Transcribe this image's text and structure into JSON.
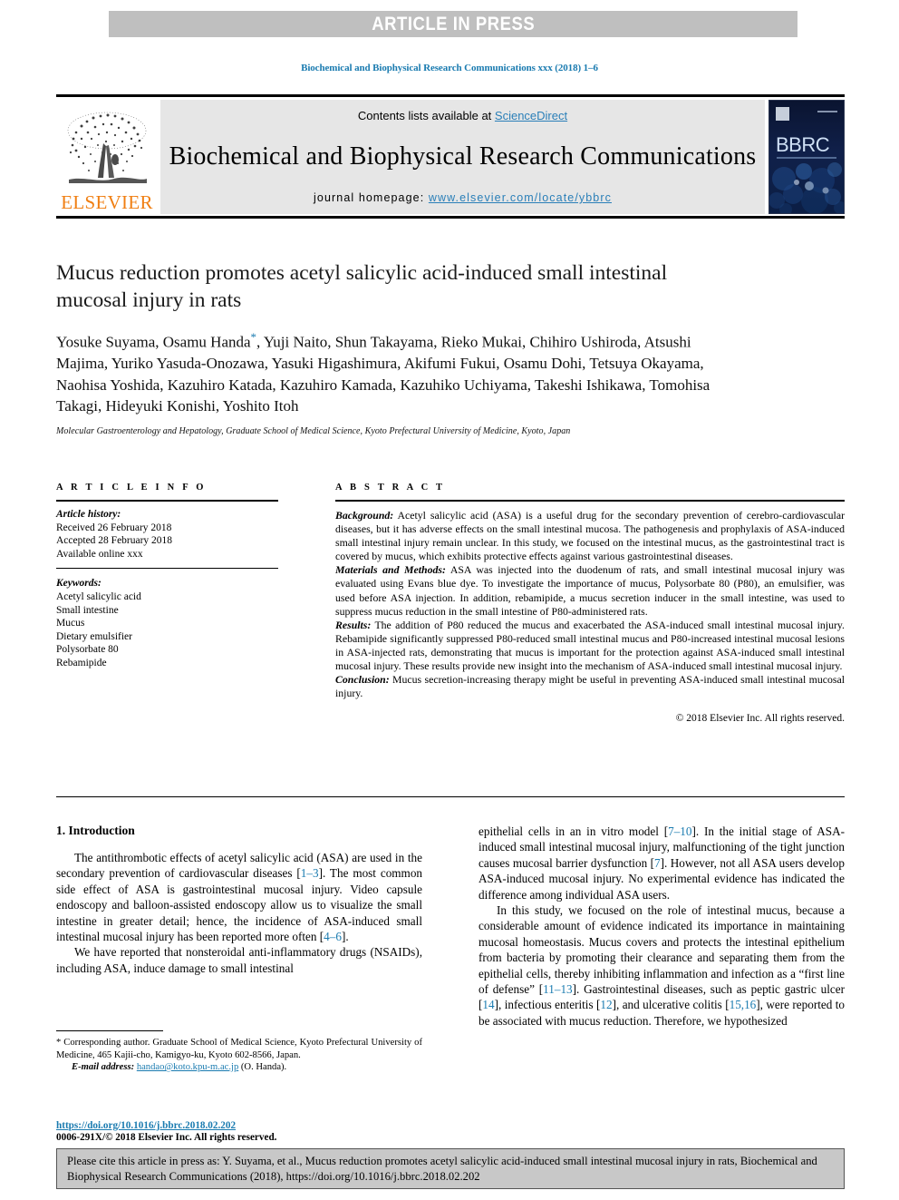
{
  "banner": {
    "label": "ARTICLE IN PRESS"
  },
  "running_head": "Biochemical and Biophysical Research Communications xxx (2018) 1–6",
  "masthead": {
    "publisher": "ELSEVIER",
    "contents_prefix": "Contents lists available at ",
    "contents_link": "ScienceDirect",
    "journal_title": "Biochemical and Biophysical Research Communications",
    "homepage_label": "journal homepage: ",
    "homepage_link": "www.elsevier.com/locate/ybbrc",
    "cover_code": "BBRC"
  },
  "article": {
    "title": "Mucus reduction promotes acetyl salicylic acid-induced small intestinal mucosal injury in rats",
    "authors": "Yosuke Suyama, Osamu Handa",
    "authors_rest": ", Yuji Naito, Shun Takayama, Rieko Mukai, Chihiro Ushiroda, Atsushi Majima, Yuriko Yasuda-Onozawa, Yasuki Higashimura, Akifumi Fukui, Osamu Dohi, Tetsuya Okayama, Naohisa Yoshida, Kazuhiro Katada, Kazuhiro Kamada, Kazuhiko Uchiyama, Takeshi Ishikawa, Tomohisa Takagi, Hideyuki Konishi, Yoshito Itoh",
    "corresponding_marker": "*",
    "affiliation": "Molecular Gastroenterology and Hepatology, Graduate School of Medical Science, Kyoto Prefectural University of Medicine, Kyoto, Japan"
  },
  "article_info": {
    "heading": "A R T I C L E   I N F O",
    "history_label": "Article history:",
    "history": [
      "Received 26 February 2018",
      "Accepted 28 February 2018",
      "Available online xxx"
    ],
    "keywords_label": "Keywords:",
    "keywords": [
      "Acetyl salicylic acid",
      "Small intestine",
      "Mucus",
      "Dietary emulsifier",
      "Polysorbate 80",
      "Rebamipide"
    ]
  },
  "abstract": {
    "heading": "A B S T R A C T",
    "sections": [
      {
        "label": "Background:",
        "text": " Acetyl salicylic acid (ASA) is a useful drug for the secondary prevention of cerebro-cardiovascular diseases, but it has adverse effects on the small intestinal mucosa. The pathogenesis and prophylaxis of ASA-induced small intestinal injury remain unclear. In this study, we focused on the intestinal mucus, as the gastrointestinal tract is covered by mucus, which exhibits protective effects against various gastrointestinal diseases."
      },
      {
        "label": "Materials and Methods:",
        "text": " ASA was injected into the duodenum of rats, and small intestinal mucosal injury was evaluated using Evans blue dye. To investigate the importance of mucus, Polysorbate 80 (P80), an emulsifier, was used before ASA injection. In addition, rebamipide, a mucus secretion inducer in the small intestine, was used to suppress mucus reduction in the small intestine of P80-administered rats."
      },
      {
        "label": "Results:",
        "text": " The addition of P80 reduced the mucus and exacerbated the ASA-induced small intestinal mucosal injury. Rebamipide significantly suppressed P80-reduced small intestinal mucus and P80-increased intestinal mucosal lesions in ASA-injected rats, demonstrating that mucus is important for the protection against ASA-induced small intestinal mucosal injury. These results provide new insight into the mechanism of ASA-induced small intestinal mucosal injury."
      },
      {
        "label": "Conclusion:",
        "text": " Mucus secretion-increasing therapy might be useful in preventing ASA-induced small intestinal mucosal injury."
      }
    ],
    "copyright": "© 2018 Elsevier Inc. All rights reserved."
  },
  "introduction": {
    "heading": "1. Introduction",
    "left_paragraphs": [
      {
        "runs": [
          {
            "t": "The antithrombotic effects of acetyl salicylic acid (ASA) are used in the secondary prevention of cardiovascular diseases ["
          },
          {
            "t": "1–3",
            "ref": true
          },
          {
            "t": "]. The most common side effect of ASA is gastrointestinal mucosal injury. Video capsule endoscopy and balloon-assisted endoscopy allow us to visualize the small intestine in greater detail; hence, the incidence of ASA-induced small intestinal mucosal injury has been reported more often ["
          },
          {
            "t": "4–6",
            "ref": true
          },
          {
            "t": "]."
          }
        ]
      },
      {
        "runs": [
          {
            "t": "We have reported that nonsteroidal anti-inflammatory drugs (NSAIDs), including ASA, induce damage to small intestinal"
          }
        ]
      }
    ],
    "right_paragraphs": [
      {
        "runs": [
          {
            "t": "epithelial cells in an in vitro model ["
          },
          {
            "t": "7–10",
            "ref": true
          },
          {
            "t": "]. In the initial stage of ASA-induced small intestinal mucosal injury, malfunctioning of the tight junction causes mucosal barrier dysfunction ["
          },
          {
            "t": "7",
            "ref": true
          },
          {
            "t": "]. However, not all ASA users develop ASA-induced mucosal injury. No experimental evidence has indicated the difference among individual ASA users."
          }
        ],
        "noindent": true
      },
      {
        "runs": [
          {
            "t": "In this study, we focused on the role of intestinal mucus, because a considerable amount of evidence indicated its importance in maintaining mucosal homeostasis. Mucus covers and protects the intestinal epithelium from bacteria by promoting their clearance and separating them from the epithelial cells, thereby inhibiting inflammation and infection as a “first line of defense” ["
          },
          {
            "t": "11–13",
            "ref": true
          },
          {
            "t": "]. Gastrointestinal diseases, such as peptic gastric ulcer ["
          },
          {
            "t": "14",
            "ref": true
          },
          {
            "t": "], infectious enteritis ["
          },
          {
            "t": "12",
            "ref": true
          },
          {
            "t": "], and ulcerative colitis ["
          },
          {
            "t": "15,16",
            "ref": true
          },
          {
            "t": "], were reported to be associated with mucus reduction. Therefore, we hypothesized"
          }
        ]
      }
    ]
  },
  "footnote": {
    "corresponding": "* Corresponding author. Graduate School of Medical Science, Kyoto Prefectural University of Medicine, 465 Kajii-cho, Kamigyo-ku, Kyoto 602-8566, Japan.",
    "email_label": "E-mail address:",
    "email": "handao@koto.kpu-m.ac.jp",
    "email_suffix": " (O. Handa).",
    "doi": "https://doi.org/10.1016/j.bbrc.2018.02.202",
    "issn": "0006-291X/© 2018 Elsevier Inc. All rights reserved."
  },
  "cite_banner": {
    "text": "Please cite this article in press as: Y. Suyama, et al., Mucus reduction promotes acetyl salicylic acid-induced small intestinal mucosal injury in rats, Biochemical and Biophysical Research Communications (2018), https://doi.org/10.1016/j.bbrc.2018.02.202"
  },
  "colors": {
    "link": "#1a7bb0",
    "banner_bg": "#bfbfbf",
    "masthead_bg": "#e6e6e6",
    "elsevier_orange": "#f07f13",
    "cite_bg": "#c8c8c8"
  }
}
